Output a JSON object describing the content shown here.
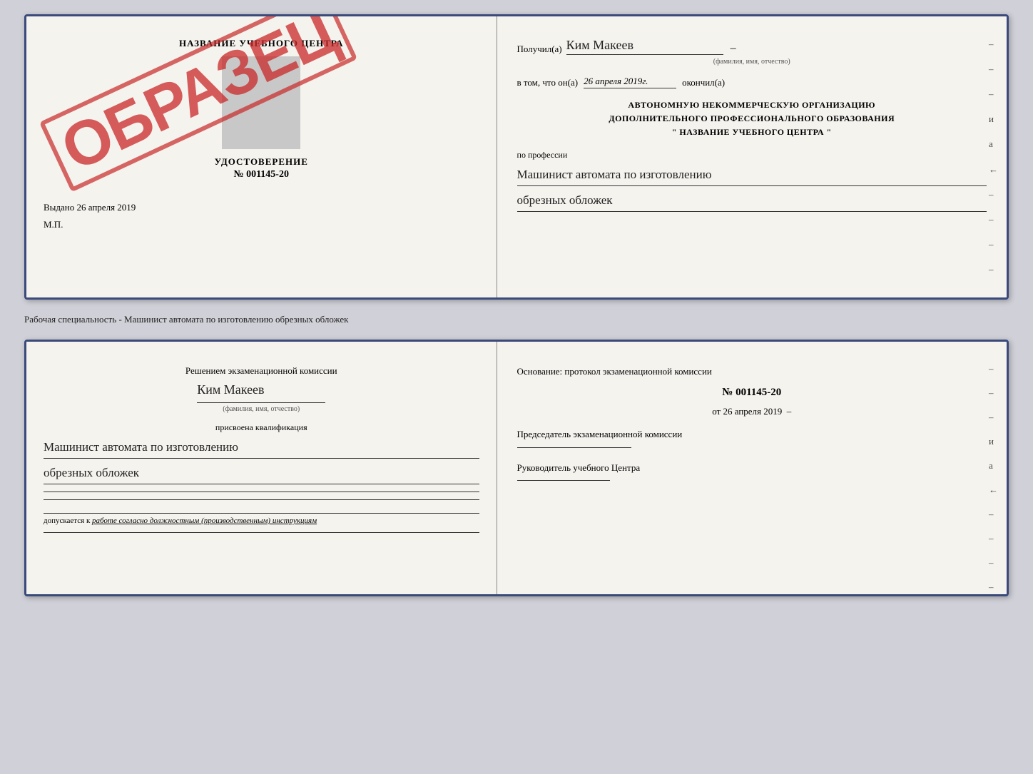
{
  "topDoc": {
    "left": {
      "schoolTitle": "НАЗВАНИЕ УЧЕБНОГО ЦЕНТРА",
      "udostoverenieLabel": "УДОСТОВЕРЕНИЕ",
      "docNumber": "№ 001145-20",
      "vydanoLabel": "Выдано",
      "vydanoDate": "26 апреля 2019",
      "mpLabel": "М.П.",
      "obrazecText": "ОБРАЗЕЦ"
    },
    "right": {
      "poluchilLabel": "Получил(а)",
      "fioValue": "Ким Макеев",
      "fioSubLabel": "(фамилия, имя, отчество)",
      "vtomLabel": "в том, что он(а)",
      "vtomDate": "26 апреля 2019г.",
      "okoncilLabel": "окончил(а)",
      "orgLine1": "АВТОНОМНУЮ НЕКОММЕРЧЕСКУЮ ОРГАНИЗАЦИЮ",
      "orgLine2": "ДОПОЛНИТЕЛЬНОГО ПРОФЕССИОНАЛЬНОГО ОБРАЗОВАНИЯ",
      "orgLine3": "\" НАЗВАНИЕ УЧЕБНОГО ЦЕНТРА \"",
      "poProfessiiLabel": "по профессии",
      "professionValue1": "Машинист автомата по изготовлению",
      "professionValue2": "обрезных обложек"
    }
  },
  "separatorLabel": "Рабочая специальность - Машинист автомата по изготовлению обрезных обложек",
  "bottomDoc": {
    "left": {
      "reshenieLabel": "Решением экзаменационной комиссии",
      "fioValue": "Ким Макеев",
      "fioSubLabel": "(фамилия, имя, отчество)",
      "prisvoenaLabel": "присвоена квалификация",
      "kvalifValue1": "Машинист автомата по изготовлению",
      "kvalifValue2": "обрезных обложек",
      "dopuskaetsyaLabel": "допускается к",
      "dopuskaetsyaValue": "работе согласно должностным (производственным) инструкциям"
    },
    "right": {
      "osnovanieLabelPrefix": "Основание: протокол экзаменационной комиссии",
      "protoNum": "№ 001145-20",
      "otLabel": "от",
      "otDate": "26 апреля 2019",
      "predsedatelLabel": "Председатель экзаменационной комиссии",
      "rukovoditelLabel": "Руководитель учебного Центра"
    }
  },
  "rightSideDashes": [
    "-",
    "-",
    "-",
    "и",
    "а",
    "←",
    "-",
    "-",
    "-",
    "-"
  ],
  "bottomRightDashes": [
    "-",
    "-",
    "-",
    "и",
    "а",
    "←",
    "-",
    "-",
    "-",
    "-"
  ]
}
